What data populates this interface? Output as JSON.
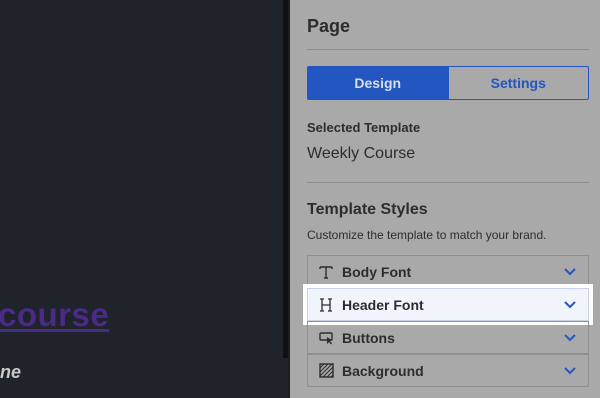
{
  "canvas": {
    "link_text": "course",
    "fragment_text": "ne"
  },
  "panel": {
    "title": "Page",
    "tabs": [
      {
        "label": "Design",
        "active": true
      },
      {
        "label": "Settings",
        "active": false
      }
    ],
    "selected_template_label": "Selected Template",
    "selected_template_value": "Weekly Course",
    "styles_title": "Template Styles",
    "styles_description": "Customize the template to match your brand.",
    "accordion": [
      {
        "label": "Body Font",
        "icon": "text-type-icon"
      },
      {
        "label": "Header Font",
        "icon": "heading-icon",
        "highlighted": true
      },
      {
        "label": "Buttons",
        "icon": "button-cursor-icon"
      },
      {
        "label": "Background",
        "icon": "background-pattern-icon"
      }
    ]
  },
  "colors": {
    "accent": "#2456c2",
    "panel_bg": "#a9a9a9",
    "canvas_bg": "#1f232a",
    "link": "#4a2a86"
  }
}
